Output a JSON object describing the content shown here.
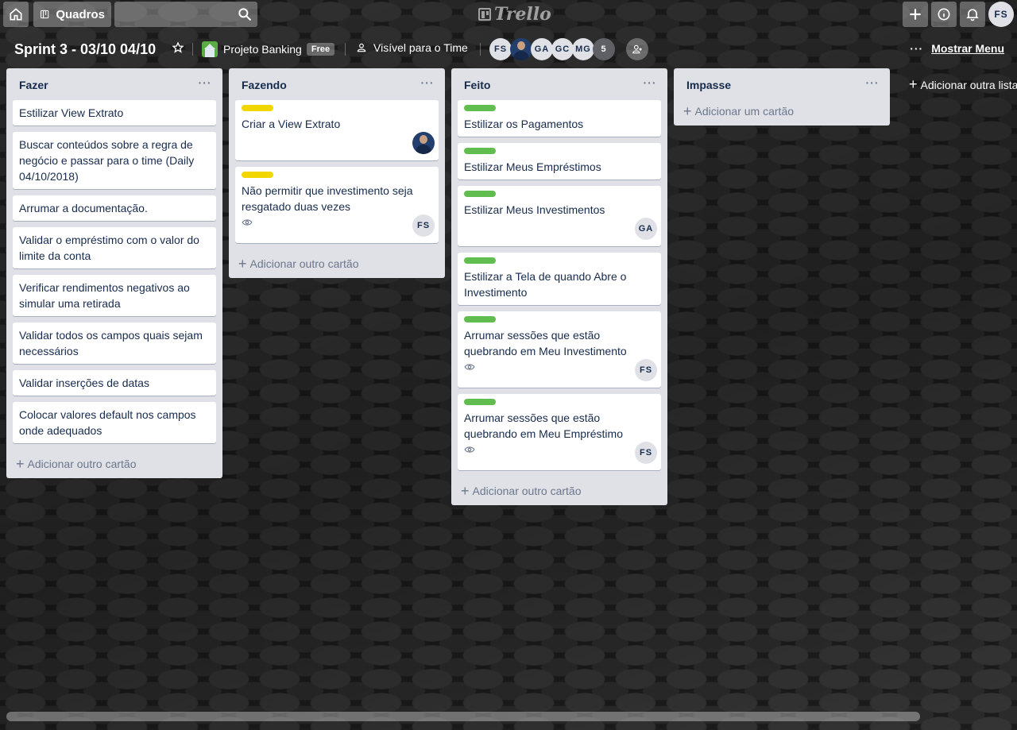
{
  "header": {
    "boards_label": "Quadros",
    "search_placeholder": "",
    "logo_text": "Trello",
    "user_initials": "FS"
  },
  "board": {
    "title": "Sprint 3 - 03/10 04/10",
    "team_name": "Projeto Banking",
    "team_badge": "Free",
    "visibility": "Visível para o Time",
    "members": [
      "FS",
      "",
      "GA",
      "GC",
      "MG"
    ],
    "members_more": "5",
    "show_menu": "Mostrar Menu",
    "add_list": "Adicionar outra lista"
  },
  "lists": [
    {
      "title": "Fazer",
      "add_card": "Adicionar outro cartão",
      "cards": [
        {
          "text": "Estilizar View Extrato"
        },
        {
          "text": "Buscar conteúdos sobre a regra de negócio e passar para o time (Daily 04/10/2018)"
        },
        {
          "text": "Arrumar a documentação."
        },
        {
          "text": "Validar o empréstimo com o valor do limite da conta"
        },
        {
          "text": "Verificar rendimentos negativos ao simular uma retirada"
        },
        {
          "text": "Validar todos os campos quais sejam necessários"
        },
        {
          "text": "Validar inserções de datas"
        },
        {
          "text": "Colocar valores default nos campos onde adequados"
        }
      ]
    },
    {
      "title": "Fazendo",
      "add_card": "Adicionar outro cartão",
      "cards": [
        {
          "text": "Criar a View Extrato",
          "label": "yellow",
          "member": "photo"
        },
        {
          "text": "Não permitir que investimento seja resgatado duas vezes",
          "label": "yellow",
          "member": "FS",
          "watch": true
        }
      ]
    },
    {
      "title": "Feito",
      "add_card": "Adicionar outro cartão",
      "cards": [
        {
          "text": "Estilizar os Pagamentos",
          "label": "green"
        },
        {
          "text": "Estilizar Meus Empréstimos",
          "label": "green"
        },
        {
          "text": "Estilizar Meus Investimentos",
          "label": "green",
          "member": "GA"
        },
        {
          "text": "Estilizar a Tela de quando Abre o Investimento",
          "label": "green"
        },
        {
          "text": "Arrumar sessões que estão quebrando em Meu Investimento",
          "label": "green",
          "member": "FS",
          "watch": true
        },
        {
          "text": "Arrumar sessões que estão quebrando em Meu Empréstimo",
          "label": "green",
          "member": "FS",
          "watch": true
        }
      ]
    },
    {
      "title": "Impasse",
      "add_card": "Adicionar um cartão",
      "cards": []
    }
  ]
}
